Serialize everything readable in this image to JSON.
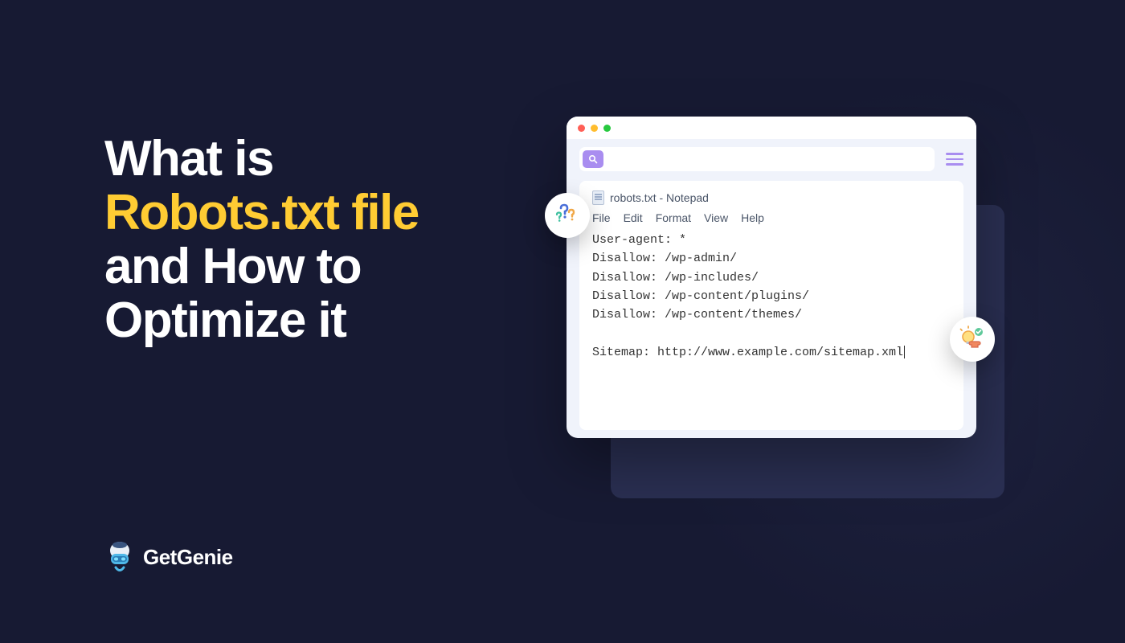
{
  "headline": {
    "line1": "What is",
    "line2": "Robots.txt file",
    "line3": "and How to",
    "line4": "Optimize it"
  },
  "logo": {
    "text": "GetGenie"
  },
  "browser": {
    "search_placeholder": ""
  },
  "notepad": {
    "title": "robots.txt - Notepad",
    "menu": [
      "File",
      "Edit",
      "Format",
      "View",
      "Help"
    ],
    "lines": [
      "User-agent: *",
      "Disallow: /wp-admin/",
      "Disallow: /wp-includes/",
      "Disallow: /wp-content/plugins/",
      "Disallow: /wp-content/themes/",
      "",
      "Sitemap: http://www.example.com/sitemap.xml"
    ]
  },
  "icons": {
    "question": "question-marks-icon",
    "idea": "lightbulb-puzzle-icon"
  }
}
